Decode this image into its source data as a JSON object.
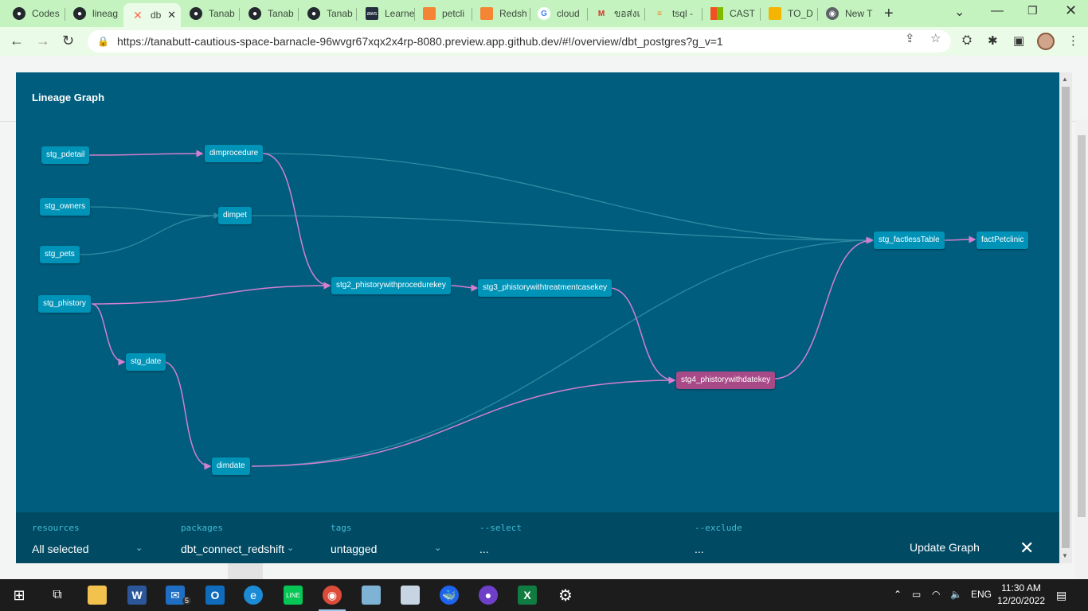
{
  "browser": {
    "tabs": [
      {
        "label": "Codes",
        "icon": "github-icon"
      },
      {
        "label": "lineag",
        "icon": "github-icon"
      },
      {
        "label": "db",
        "icon": "dbt-icon",
        "active": true
      },
      {
        "label": "Tanab",
        "icon": "github-icon"
      },
      {
        "label": "Tanab",
        "icon": "github-icon"
      },
      {
        "label": "Tanab",
        "icon": "github-icon"
      },
      {
        "label": "Learne",
        "icon": "aws-icon"
      },
      {
        "label": "petcli",
        "icon": "aws-box-icon"
      },
      {
        "label": "Redsh",
        "icon": "aws-box-icon"
      },
      {
        "label": "cloud",
        "icon": "google-icon"
      },
      {
        "label": "ขอส่งเ",
        "icon": "gmail-icon"
      },
      {
        "label": "tsql -",
        "icon": "stack-icon"
      },
      {
        "label": "CAST",
        "icon": "microsoft-icon"
      },
      {
        "label": "TO_D",
        "icon": "docs-icon"
      },
      {
        "label": "New T",
        "icon": "chrome-icon"
      }
    ],
    "url": "https://tanabutt-cautious-space-barnacle-96wvgr67xqx2x4rp-8080.preview.app.github.dev/#!/overview/dbt_postgres?g_v=1"
  },
  "panel": {
    "title": "Lineage Graph",
    "nodes": [
      {
        "id": "stg_pdetail",
        "label": "stg_pdetail",
        "selected": false
      },
      {
        "id": "dimprocedure",
        "label": "dimprocedure",
        "selected": false
      },
      {
        "id": "stg_owners",
        "label": "stg_owners",
        "selected": false
      },
      {
        "id": "dimpet",
        "label": "dimpet",
        "selected": false
      },
      {
        "id": "stg_pets",
        "label": "stg_pets",
        "selected": false
      },
      {
        "id": "stg_phistory",
        "label": "stg_phistory",
        "selected": false
      },
      {
        "id": "stg2",
        "label": "stg2_phistorywithprocedurekey",
        "selected": false
      },
      {
        "id": "stg3",
        "label": "stg3_phistorywithtreatmentcasekey",
        "selected": false
      },
      {
        "id": "stg_date",
        "label": "stg_date",
        "selected": false
      },
      {
        "id": "dimdate",
        "label": "dimdate",
        "selected": false
      },
      {
        "id": "stg4",
        "label": "stg4_phistorywithdatekey",
        "selected": true
      },
      {
        "id": "stg_factless",
        "label": "stg_factlessTable",
        "selected": false
      },
      {
        "id": "fact",
        "label": "factPetclinic",
        "selected": false
      }
    ],
    "filters": {
      "resources": {
        "label": "resources",
        "value": "All selected"
      },
      "packages": {
        "label": "packages",
        "value": "dbt_connect_redshift"
      },
      "tags": {
        "label": "tags",
        "value": "untagged"
      },
      "select": {
        "label": "--select",
        "value": "..."
      },
      "exclude": {
        "label": "--exclude",
        "value": "..."
      }
    },
    "update_label": "Update Graph",
    "close_glyph": "✕",
    "colors": {
      "background": "#005d7d",
      "node": "#0093b8",
      "selected_node": "#a84a88",
      "edge_highlight": "#d47fd0",
      "edge_dim": "#2f8aa3"
    }
  },
  "taskbar": {
    "mail_badge": "5",
    "language": "ENG",
    "time": "11:30 AM",
    "date": "12/20/2022"
  }
}
